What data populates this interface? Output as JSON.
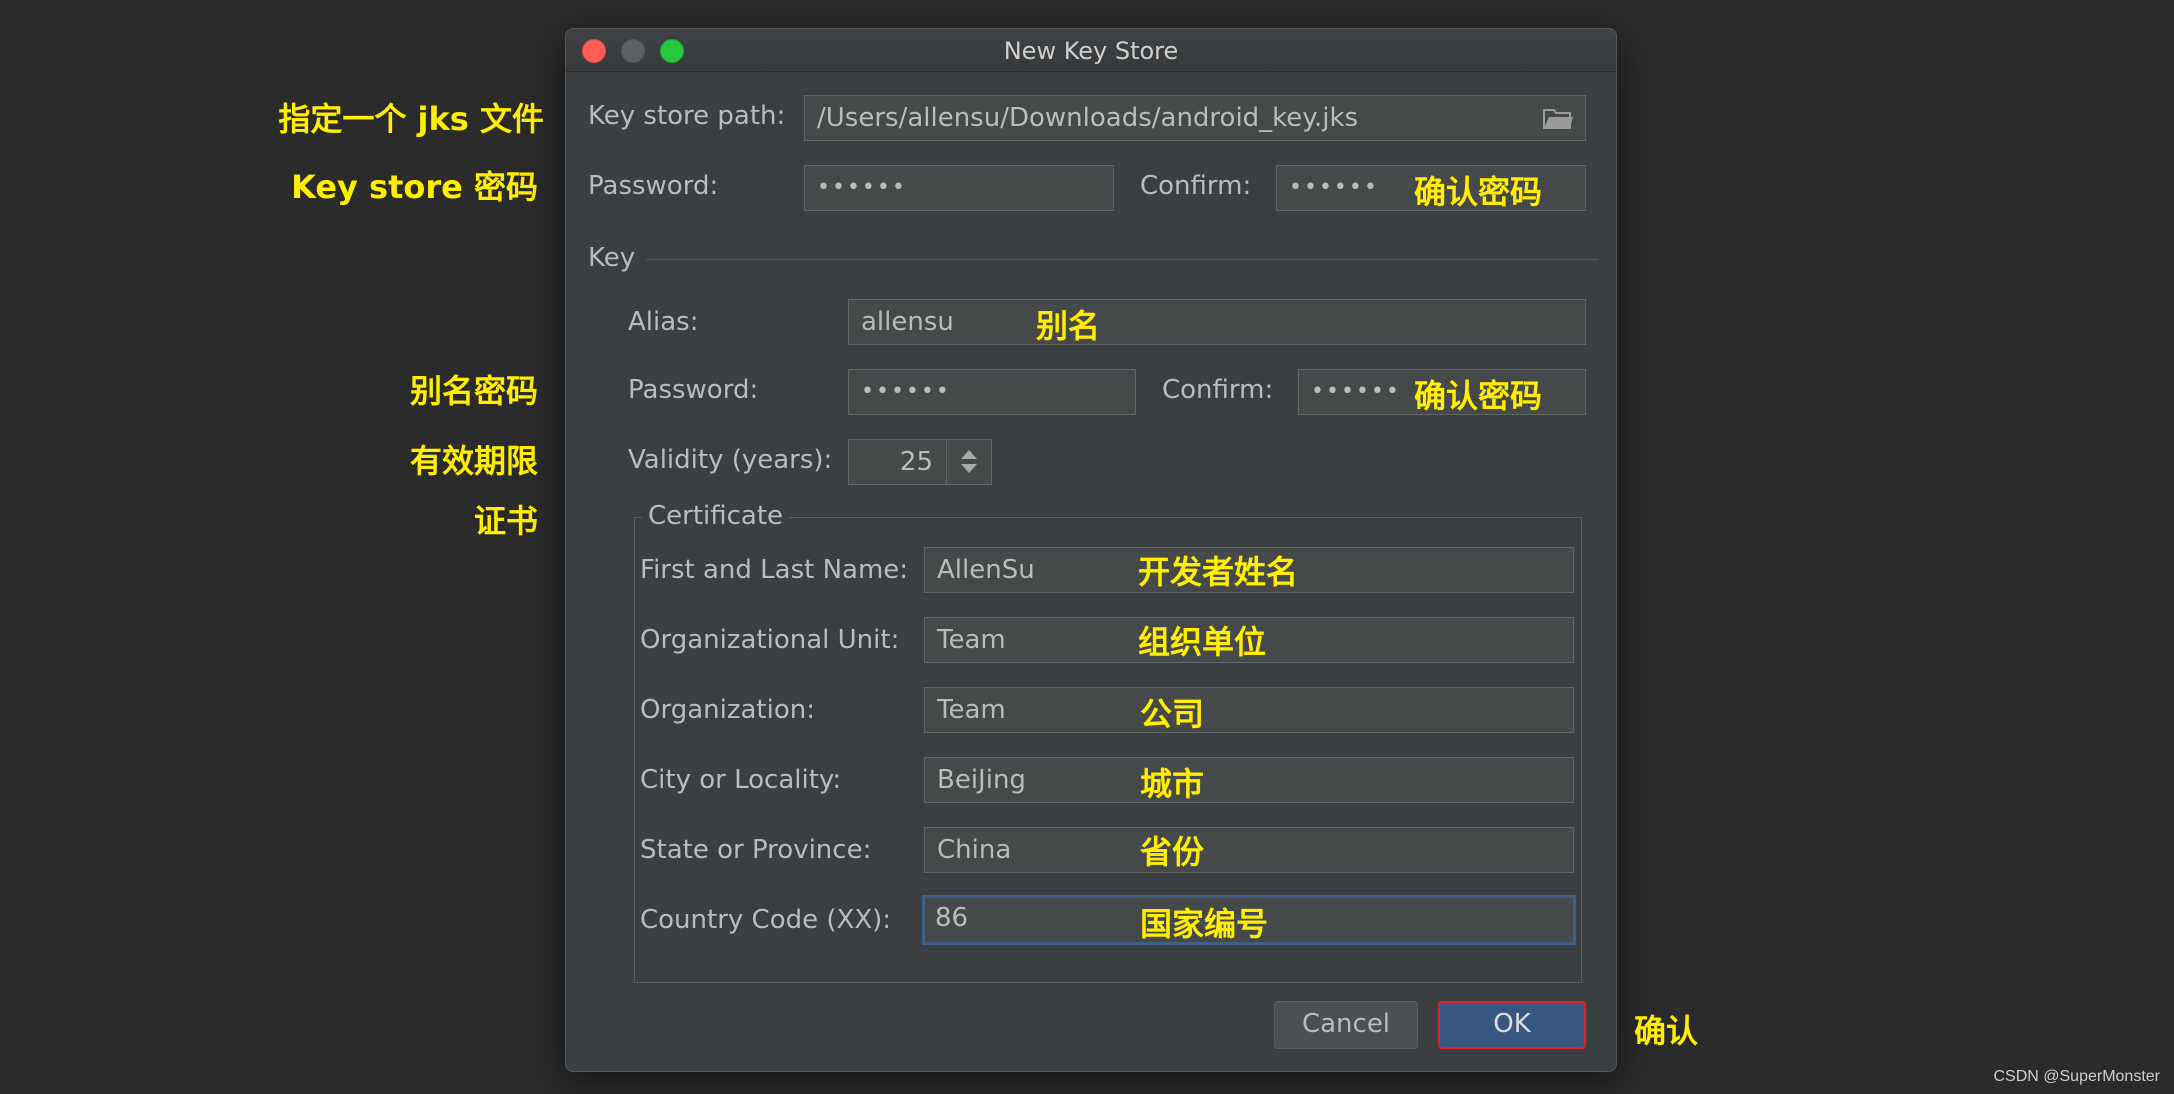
{
  "dialog": {
    "title": "New Key Store"
  },
  "keystore": {
    "path_label": "Key store path:",
    "path_value": "/Users/allensu/Downloads/android_key.jks",
    "password_label": "Password:",
    "password_value": "••••••",
    "confirm_label": "Confirm:",
    "confirm_value": "••••••"
  },
  "key": {
    "section_label": "Key",
    "alias_label": "Alias:",
    "alias_value": "allensu",
    "password_label": "Password:",
    "password_value": "••••••",
    "confirm_label": "Confirm:",
    "confirm_value": "••••••",
    "validity_label": "Validity (years):",
    "validity_value": "25"
  },
  "certificate": {
    "legend": "Certificate",
    "fields": [
      {
        "label": "First and Last Name:",
        "value": "AllenSu"
      },
      {
        "label": "Organizational Unit:",
        "value": "Team"
      },
      {
        "label": "Organization:",
        "value": "Team"
      },
      {
        "label": "City or Locality:",
        "value": "BeiJing"
      },
      {
        "label": "State or Province:",
        "value": "China"
      },
      {
        "label": "Country Code (XX):",
        "value": "86"
      }
    ]
  },
  "buttons": {
    "cancel": "Cancel",
    "ok": "OK"
  },
  "annotations": {
    "left": {
      "jks_file": "指定一个 jks 文件",
      "keystore_password": "Key store 密码",
      "alias_password": "别名密码",
      "validity": "有效期限",
      "certificate": "证书"
    },
    "inline": {
      "confirm_password_1": "确认密码",
      "alias": "别名",
      "confirm_password_2": "确认密码",
      "name": "开发者姓名",
      "org_unit": "组织单位",
      "organization": "公司",
      "city": "城市",
      "province": "省份",
      "country": "国家编号"
    },
    "ok": "确认"
  },
  "watermark": "CSDN @SuperMonster"
}
